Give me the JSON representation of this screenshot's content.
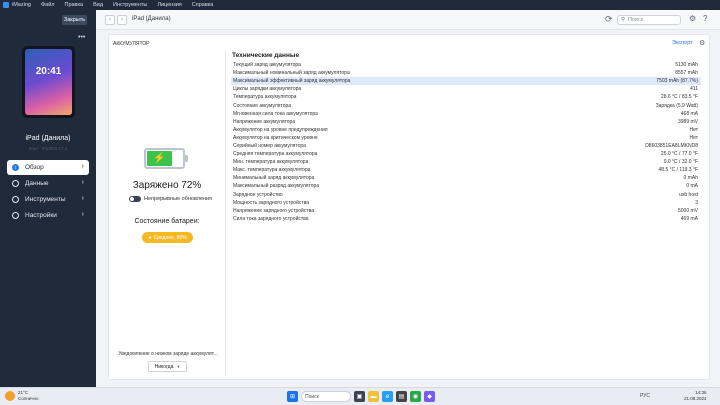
{
  "menubar": {
    "items": [
      "iMazing",
      "Файл",
      "Правка",
      "Вид",
      "Инструменты",
      "Лицензия",
      "Справка"
    ]
  },
  "sidebar": {
    "close_label": "Закрыть",
    "more_label": "•••",
    "device_time": "20:41",
    "device_name": "iPad (Данила)",
    "device_sub": "iPad · iPadOS 17.5",
    "nav": [
      {
        "label": "Обзор",
        "icon": "info-icon",
        "active": true
      },
      {
        "label": "Данные",
        "icon": "folder-icon",
        "active": false
      },
      {
        "label": "Инструменты",
        "icon": "tools-icon",
        "active": false
      },
      {
        "label": "Настройки",
        "icon": "gear-icon",
        "active": false
      }
    ]
  },
  "toolbar": {
    "back": "‹",
    "forward": "›",
    "breadcrumb": "iPad (Данила)",
    "search_placeholder": "Поиск"
  },
  "panel": {
    "title": "АККУМУЛЯТОР",
    "export_label": "Экспорт",
    "charge_text": "Заряжено 72%",
    "charge_level": 0.72,
    "accent_color": "#3dc24a",
    "continuous_updates": "Непрерывные обновления",
    "state_label": "Состояние батареи:",
    "state_value": "Среднее, 86%",
    "state_color": "#f4b822",
    "notify_label": "Уведомление о низком заряде аккумулят...",
    "notify_value": "Никогда"
  },
  "tech": {
    "title": "Технические данные",
    "rows": [
      {
        "label": "Текущий заряд аккумулятора",
        "value": "5130 mAh"
      },
      {
        "label": "Максимальный номинальный заряд аккумулятора",
        "value": "8557 mAh"
      },
      {
        "label": "Максимальный эффективный заряд аккумулятора",
        "value": "7503 mAh (87.7%)",
        "highlight": true
      },
      {
        "label": "Циклы зарядки аккумулятора",
        "value": "411"
      },
      {
        "label": "Температура аккумулятора",
        "value": "28.6 °C / 83.5 °F"
      },
      {
        "label": "Состояние аккумулятора",
        "value": "Зарядка (5.9 Watt)"
      },
      {
        "label": "Мгновенная сила тока аккумулятора",
        "value": "468 mA"
      },
      {
        "label": "Напряжение аккумулятора",
        "value": "3989 mV"
      },
      {
        "label": "Аккумулятор на уровне предупреждения",
        "value": "Нет"
      },
      {
        "label": "Аккумулятор на критическом уровне",
        "value": "Нет"
      },
      {
        "label": "Серийный номер аккумулятора",
        "value": "D8603851EA8LMKND8"
      },
      {
        "label": "Средняя температура аккумулятора",
        "value": "25.0 °C / 77.0 °F"
      },
      {
        "label": "Мин. температура аккумулятора",
        "value": "0.0 °C / 32.0 °F"
      },
      {
        "label": "Макс. температура аккумулятора",
        "value": "48.5 °C / 119.3 °F"
      },
      {
        "label": "Минимальный заряд аккумулятора",
        "value": "0 mAh"
      },
      {
        "label": "Максимальный разряд аккумулятора",
        "value": "0 mA"
      },
      {
        "label": "Зарядное устройство",
        "value": "usb host"
      },
      {
        "label": "Мощность зарядного устройства",
        "value": "3"
      },
      {
        "label": "Напряжение зарядного устройства",
        "value": "5000 mV"
      },
      {
        "label": "Сила тока зарядного устройства",
        "value": "469 mA"
      }
    ]
  },
  "taskbar": {
    "temp": "21°C",
    "weather": "Солнечно",
    "search": "Поиск",
    "time": "14:36",
    "date": "21.08.2024",
    "lang": "РУС"
  }
}
